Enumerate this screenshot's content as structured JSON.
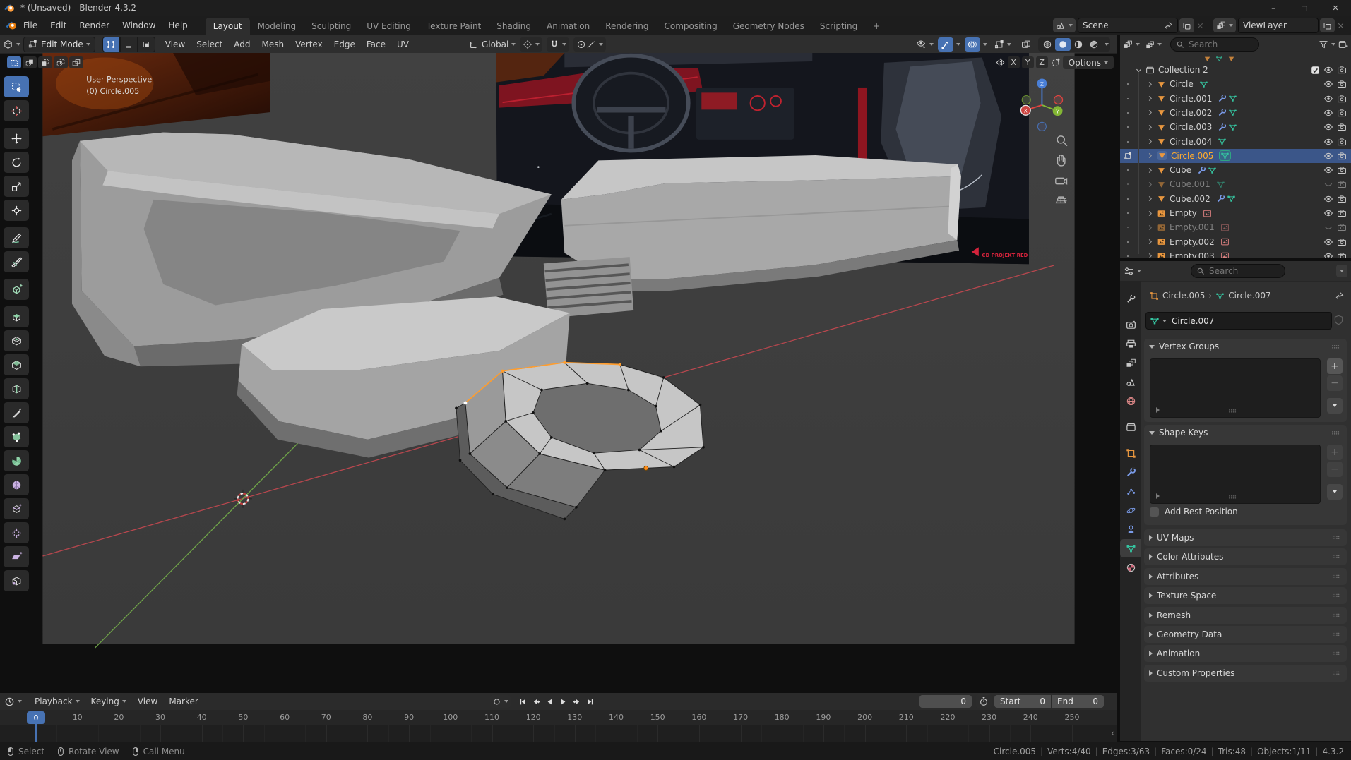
{
  "window": {
    "title": "* (Unsaved) - Blender 4.3.2",
    "controls": [
      "minimize",
      "maximize",
      "close"
    ],
    "control_glyphs": [
      "–",
      "◻",
      "✕"
    ]
  },
  "topbar": {
    "menus": [
      "File",
      "Edit",
      "Render",
      "Window",
      "Help"
    ],
    "tabs": [
      "Layout",
      "Modeling",
      "Sculpting",
      "UV Editing",
      "Texture Paint",
      "Shading",
      "Animation",
      "Rendering",
      "Compositing",
      "Geometry Nodes",
      "Scripting"
    ],
    "active_tab": "Layout",
    "add_tab": "+",
    "scene": "Scene",
    "view_layer": "ViewLayer"
  },
  "vheader": {
    "mode": "Edit Mode",
    "select_modes": [
      "vertex",
      "edge",
      "face"
    ],
    "active_select_mode": "vertex",
    "menus": [
      "View",
      "Select",
      "Add",
      "Mesh",
      "Vertex",
      "Edge",
      "Face",
      "UV"
    ],
    "orientation": "Global",
    "right_icons": [
      "object-type-visibility",
      "show-gizmos",
      "show-overlays",
      "mesh-edit-overlays",
      "toggle-xray"
    ],
    "shading_modes": [
      "wireframe",
      "solid",
      "material-preview",
      "rendered"
    ],
    "active_shading": "solid"
  },
  "tool_settings": {
    "mirror_axes": [
      "X",
      "Y",
      "Z"
    ],
    "options_label": "Options",
    "select_modes": [
      "new",
      "extend",
      "subtract",
      "invert",
      "intersect"
    ],
    "active_select_mode": "new"
  },
  "toolbar": {
    "tools": [
      {
        "name": "select-box",
        "icon": "t_select",
        "active": true
      },
      {
        "name": "cursor",
        "icon": "t_cursor"
      },
      {
        "name": "move",
        "icon": "t_move",
        "gap": true
      },
      {
        "name": "rotate",
        "icon": "t_rotate"
      },
      {
        "name": "scale",
        "icon": "t_scale"
      },
      {
        "name": "transform",
        "icon": "t_transform"
      },
      {
        "name": "annotate",
        "icon": "t_annotate",
        "gap": true
      },
      {
        "name": "measure",
        "icon": "t_measure"
      },
      {
        "name": "add-cube",
        "icon": "t_addcube",
        "gap": true
      },
      {
        "name": "extrude-region",
        "icon": "t_extrude",
        "gap": true
      },
      {
        "name": "inset-faces",
        "icon": "t_inset"
      },
      {
        "name": "bevel",
        "icon": "t_bevel"
      },
      {
        "name": "loop-cut",
        "icon": "t_loopcut"
      },
      {
        "name": "knife",
        "icon": "t_knife"
      },
      {
        "name": "poly-build",
        "icon": "t_polybuild"
      },
      {
        "name": "spin",
        "icon": "t_spin"
      },
      {
        "name": "smooth",
        "icon": "t_smooth"
      },
      {
        "name": "edge-slide",
        "icon": "t_edgeslide"
      },
      {
        "name": "shrink-fatten",
        "icon": "t_shrink"
      },
      {
        "name": "shear",
        "icon": "t_shear"
      },
      {
        "name": "rip-region",
        "icon": "t_rip"
      }
    ]
  },
  "viewport": {
    "overlay_line1": "User Perspective",
    "overlay_line2": "(0) Circle.005",
    "ref_logo": "CD PROJEKT RED",
    "axis_x": "X",
    "axis_y": "Y",
    "axis_z": "Z",
    "nav_icons": [
      "zoom",
      "pan-hand",
      "camera-view",
      "toggle-perspective"
    ]
  },
  "outliner": {
    "search_placeholder": "Search",
    "rows": [
      {
        "name": "Collection 2",
        "kind": "collection",
        "expanded": true,
        "checkbox": true,
        "eye": "open",
        "camera": true
      },
      {
        "name": "Circle",
        "kind": "mesh",
        "data": true,
        "eye": "open",
        "camera": true
      },
      {
        "name": "Circle.001",
        "kind": "mesh",
        "mod": true,
        "data": true,
        "eye": "open",
        "camera": true
      },
      {
        "name": "Circle.002",
        "kind": "mesh",
        "mod": true,
        "data": true,
        "eye": "open",
        "camera": true
      },
      {
        "name": "Circle.003",
        "kind": "mesh",
        "mod": true,
        "data": true,
        "eye": "open",
        "camera": true
      },
      {
        "name": "Circle.004",
        "kind": "mesh",
        "data": true,
        "eye": "open",
        "camera": true
      },
      {
        "name": "Circle.005",
        "kind": "mesh",
        "data": true,
        "eye": "open",
        "camera": true,
        "selected": true,
        "editmode": true
      },
      {
        "name": "Cube",
        "kind": "mesh",
        "mod": true,
        "data": true,
        "eye": "open",
        "camera": true
      },
      {
        "name": "Cube.001",
        "kind": "mesh",
        "data": true,
        "dim": true,
        "eye": "closed",
        "camera": true
      },
      {
        "name": "Cube.002",
        "kind": "mesh",
        "mod": true,
        "data": true,
        "eye": "open",
        "camera": true
      },
      {
        "name": "Empty",
        "kind": "empty",
        "data": true,
        "eye": "open",
        "camera": true
      },
      {
        "name": "Empty.001",
        "kind": "empty",
        "data": true,
        "dim": true,
        "eye": "closed",
        "camera": true
      },
      {
        "name": "Empty.002",
        "kind": "empty",
        "data": true,
        "eye": "open",
        "camera": true
      },
      {
        "name": "Empty.003",
        "kind": "empty",
        "data": true,
        "eye": "open",
        "camera": true
      }
    ]
  },
  "properties": {
    "search_placeholder": "Search",
    "breadcrumb_object": "Circle.005",
    "breadcrumb_data": "Circle.007",
    "name_value": "Circle.007",
    "vertex_groups_label": "Vertex Groups",
    "shape_keys_label": "Shape Keys",
    "add_rest_label": "Add Rest Position",
    "sections": [
      "UV Maps",
      "Color Attributes",
      "Attributes",
      "Texture Space",
      "Remesh",
      "Geometry Data",
      "Animation",
      "Custom Properties"
    ],
    "tabs": [
      {
        "name": "tool",
        "icon": "tab_tool"
      },
      {
        "name": "render",
        "icon": "tab_render",
        "gap": true
      },
      {
        "name": "output",
        "icon": "tab_output"
      },
      {
        "name": "view-layer",
        "icon": "tab_viewlayer"
      },
      {
        "name": "scene",
        "icon": "tab_scene"
      },
      {
        "name": "world",
        "icon": "tab_world"
      },
      {
        "name": "collection",
        "icon": "tab_collection",
        "gap": true
      },
      {
        "name": "object",
        "icon": "tab_object",
        "gap": true
      },
      {
        "name": "modifiers",
        "icon": "wrench"
      },
      {
        "name": "particles",
        "icon": "tab_particles"
      },
      {
        "name": "physics",
        "icon": "tab_physics"
      },
      {
        "name": "constraints",
        "icon": "tab_constraints"
      },
      {
        "name": "object-data",
        "icon": "datamesh",
        "active": true
      },
      {
        "name": "material",
        "icon": "tab_material"
      }
    ]
  },
  "timeline": {
    "menus_drop": [
      "Playback",
      "Keying"
    ],
    "menus_plain": [
      "View",
      "Marker"
    ],
    "playback": [
      "jump-to-start",
      "jump-to-prev-keyframe",
      "play-reverse",
      "play",
      "jump-to-next-keyframe",
      "jump-to-end"
    ],
    "frame_current": "0",
    "start_label": "Start",
    "start_value": "0",
    "end_label": "End",
    "end_value": "0",
    "ticks": [
      0,
      10,
      20,
      30,
      40,
      50,
      60,
      70,
      80,
      90,
      100,
      110,
      120,
      130,
      140,
      150,
      160,
      170,
      180,
      190,
      200,
      210,
      220,
      230,
      240,
      250
    ]
  },
  "statusbar": {
    "hints": [
      {
        "icon": "mouse_l",
        "label": "Select"
      },
      {
        "icon": "mouse_m",
        "label": "Rotate View"
      },
      {
        "icon": "mouse_r",
        "label": "Call Menu"
      }
    ],
    "stats": [
      "Circle.005",
      "Verts:4/40",
      "Edges:3/63",
      "Faces:0/24",
      "Tris:48",
      "Objects:1/11",
      "4.3.2"
    ]
  }
}
